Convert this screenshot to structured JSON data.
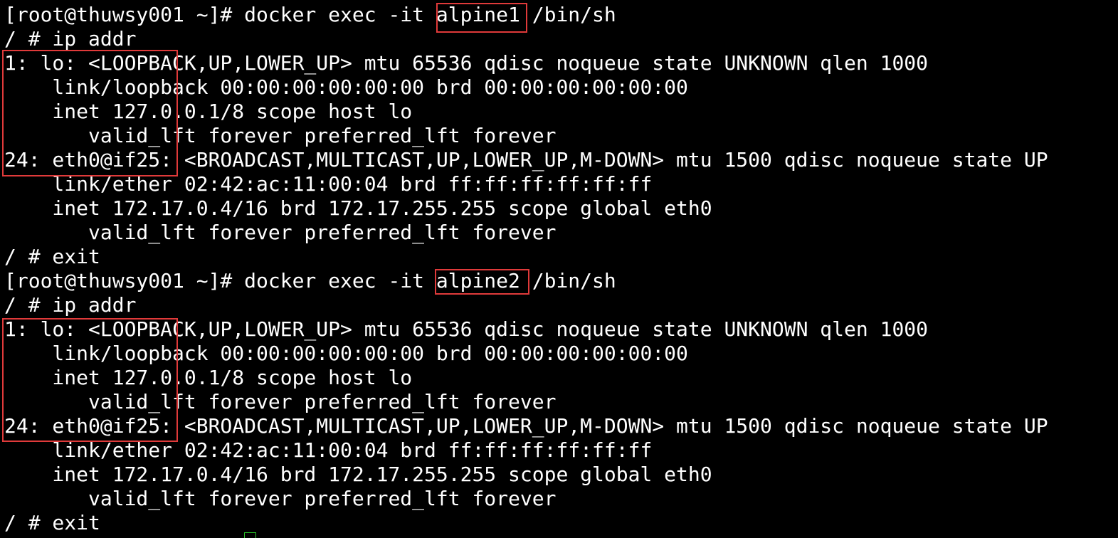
{
  "terminal": {
    "lines": [
      "[root@thuwsy001 ~]# docker exec -it alpine1 /bin/sh",
      "/ # ip addr",
      "1: lo: <LOOPBACK,UP,LOWER_UP> mtu 65536 qdisc noqueue state UNKNOWN qlen 1000",
      "    link/loopback 00:00:00:00:00:00 brd 00:00:00:00:00:00",
      "    inet 127.0.0.1/8 scope host lo",
      "       valid_lft forever preferred_lft forever",
      "24: eth0@if25: <BROADCAST,MULTICAST,UP,LOWER_UP,M-DOWN> mtu 1500 qdisc noqueue state UP",
      "    link/ether 02:42:ac:11:00:04 brd ff:ff:ff:ff:ff:ff",
      "    inet 172.17.0.4/16 brd 172.17.255.255 scope global eth0",
      "       valid_lft forever preferred_lft forever",
      "/ # exit",
      "[root@thuwsy001 ~]# docker exec -it alpine2 /bin/sh",
      "/ # ip addr",
      "1: lo: <LOOPBACK,UP,LOWER_UP> mtu 65536 qdisc noqueue state UNKNOWN qlen 1000",
      "    link/loopback 00:00:00:00:00:00 brd 00:00:00:00:00:00",
      "    inet 127.0.0.1/8 scope host lo",
      "       valid_lft forever preferred_lft forever",
      "24: eth0@if25: <BROADCAST,MULTICAST,UP,LOWER_UP,M-DOWN> mtu 1500 qdisc noqueue state UP",
      "    link/ether 02:42:ac:11:00:04 brd ff:ff:ff:ff:ff:ff",
      "    inet 172.17.0.4/16 brd 172.17.255.255 scope global eth0",
      "       valid_lft forever preferred_lft forever",
      "/ # exit"
    ]
  },
  "colors": {
    "background": "#000000",
    "text": "#ffffff",
    "highlight_box": "#e03a3a",
    "cursor": "#29c829"
  }
}
